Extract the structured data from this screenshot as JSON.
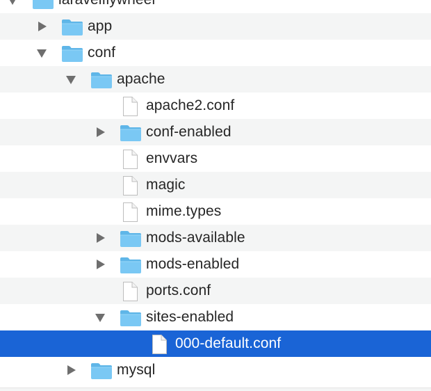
{
  "colors": {
    "folder_fill": "#7ac8f4",
    "folder_tab": "#5fb6e8",
    "selection": "#1a64d6",
    "stripe": "#f4f5f5",
    "text": "#262626",
    "disclosure": "#6e6e6e"
  },
  "tree": {
    "items": [
      {
        "label": "laravelflywheel",
        "kind": "folder",
        "icon": "folder-icon",
        "expanded": true,
        "level": 0
      },
      {
        "label": "app",
        "kind": "folder",
        "icon": "folder-icon",
        "expanded": false,
        "level": 1
      },
      {
        "label": "conf",
        "kind": "folder",
        "icon": "folder-icon",
        "expanded": true,
        "level": 1
      },
      {
        "label": "apache",
        "kind": "folder",
        "icon": "folder-icon",
        "expanded": true,
        "level": 2
      },
      {
        "label": "apache2.conf",
        "kind": "file",
        "icon": "document-icon",
        "level": 3
      },
      {
        "label": "conf-enabled",
        "kind": "folder",
        "icon": "folder-icon",
        "expanded": false,
        "level": 3
      },
      {
        "label": "envvars",
        "kind": "file",
        "icon": "document-icon",
        "level": 3
      },
      {
        "label": "magic",
        "kind": "file",
        "icon": "document-icon",
        "level": 3
      },
      {
        "label": "mime.types",
        "kind": "file",
        "icon": "document-icon",
        "level": 3
      },
      {
        "label": "mods-available",
        "kind": "folder",
        "icon": "folder-icon",
        "expanded": false,
        "level": 3
      },
      {
        "label": "mods-enabled",
        "kind": "folder",
        "icon": "folder-icon",
        "expanded": false,
        "level": 3
      },
      {
        "label": "ports.conf",
        "kind": "file",
        "icon": "document-icon",
        "level": 3
      },
      {
        "label": "sites-enabled",
        "kind": "folder",
        "icon": "folder-icon",
        "expanded": true,
        "level": 3
      },
      {
        "label": "000-default.conf",
        "kind": "file",
        "icon": "document-icon",
        "level": 4,
        "selected": true
      },
      {
        "label": "mysql",
        "kind": "folder",
        "icon": "folder-icon",
        "expanded": false,
        "level": 2
      }
    ]
  }
}
